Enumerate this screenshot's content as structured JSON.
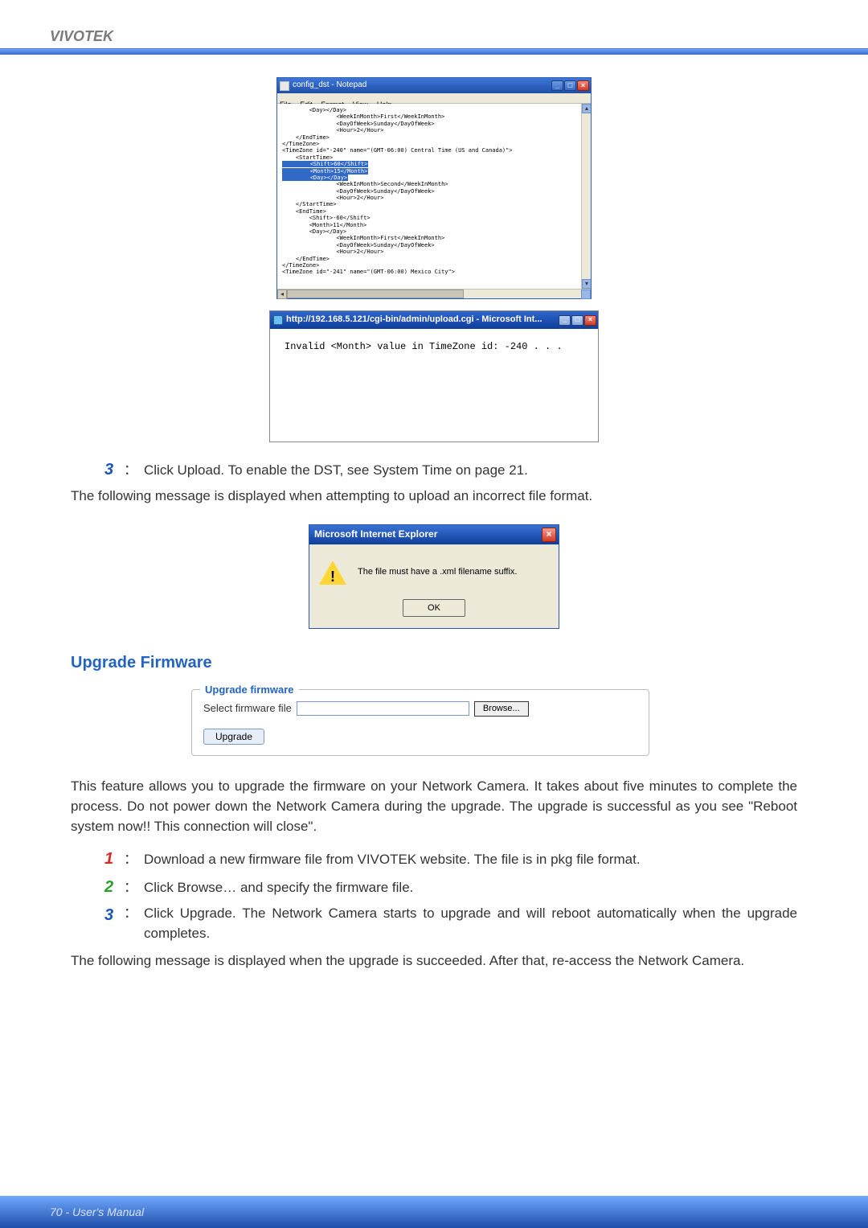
{
  "brand": "VIVOTEK",
  "notepad": {
    "title": "config_dst - Notepad",
    "menu": [
      "File",
      "Edit",
      "Format",
      "View",
      "Help"
    ],
    "xml": "        <Day></Day>\n                <WeekInMonth>First</WeekInMonth>\n                <DayOfWeek>Sunday</DayOfWeek>\n                <Hour>2</Hour>\n    </EndTime>\n</TimeZone>\n<TimeZone id=\"-240\" name=\"(GMT-06:00) Central Time (US and Canada)\">\n    <StartTime>\n        <Shift>60</Shift>\n        <Month>15</Month>\n        <Day></Day>\n                <WeekInMonth>Second</WeekInMonth>\n                <DayOfWeek>Sunday</DayOfWeek>\n                <Hour>2</Hour>\n    </StartTime>\n    <EndTime>\n        <Shift>-60</Shift>\n        <Month>11</Month>\n        <Day></Day>\n                <WeekInMonth>First</WeekInMonth>\n                <DayOfWeek>Sunday</DayOfWeek>\n                <Hour>2</Hour>\n    </EndTime>\n</TimeZone>\n<TimeZone id=\"-241\" name=\"(GMT-06:00) Mexico City\">"
  },
  "upload_win": {
    "title": "http://192.168.5.121/cgi-bin/admin/upload.cgi - Microsoft Int...",
    "body": "Invalid <Month> value in TimeZone id: -240 . . ."
  },
  "step3_top": "Click Upload. To enable the DST, see System Time on page 21.",
  "para_after_step3": "The following message is displayed when attempting to upload an incorrect file format.",
  "err_dialog": {
    "title": "Microsoft Internet Explorer",
    "msg": "The file must have a .xml filename suffix.",
    "ok": "OK"
  },
  "section_head": "Upgrade Firmware",
  "fieldset": {
    "legend": "Upgrade firmware",
    "label": "Select firmware file",
    "browse": "Browse...",
    "upgrade": "Upgrade"
  },
  "para_feature": "This feature allows you to upgrade the firmware on your Network Camera. It takes about five minutes to complete the process. Do not power down the Network Camera during the upgrade. The upgrade is successful as you see \"Reboot system now!! This connection will close\".",
  "firmware_steps": {
    "s1": "Download a new firmware file from VIVOTEK website. The file is in pkg file format.",
    "s2": "Click Browse… and specify the firmware file.",
    "s3": "Click Upgrade. The Network Camera starts to upgrade and will reboot automatically when the upgrade completes."
  },
  "para_after_steps": "The following message is displayed when the upgrade is succeeded. After that, re-access the Network Camera.",
  "footer": "70 - User's Manual"
}
